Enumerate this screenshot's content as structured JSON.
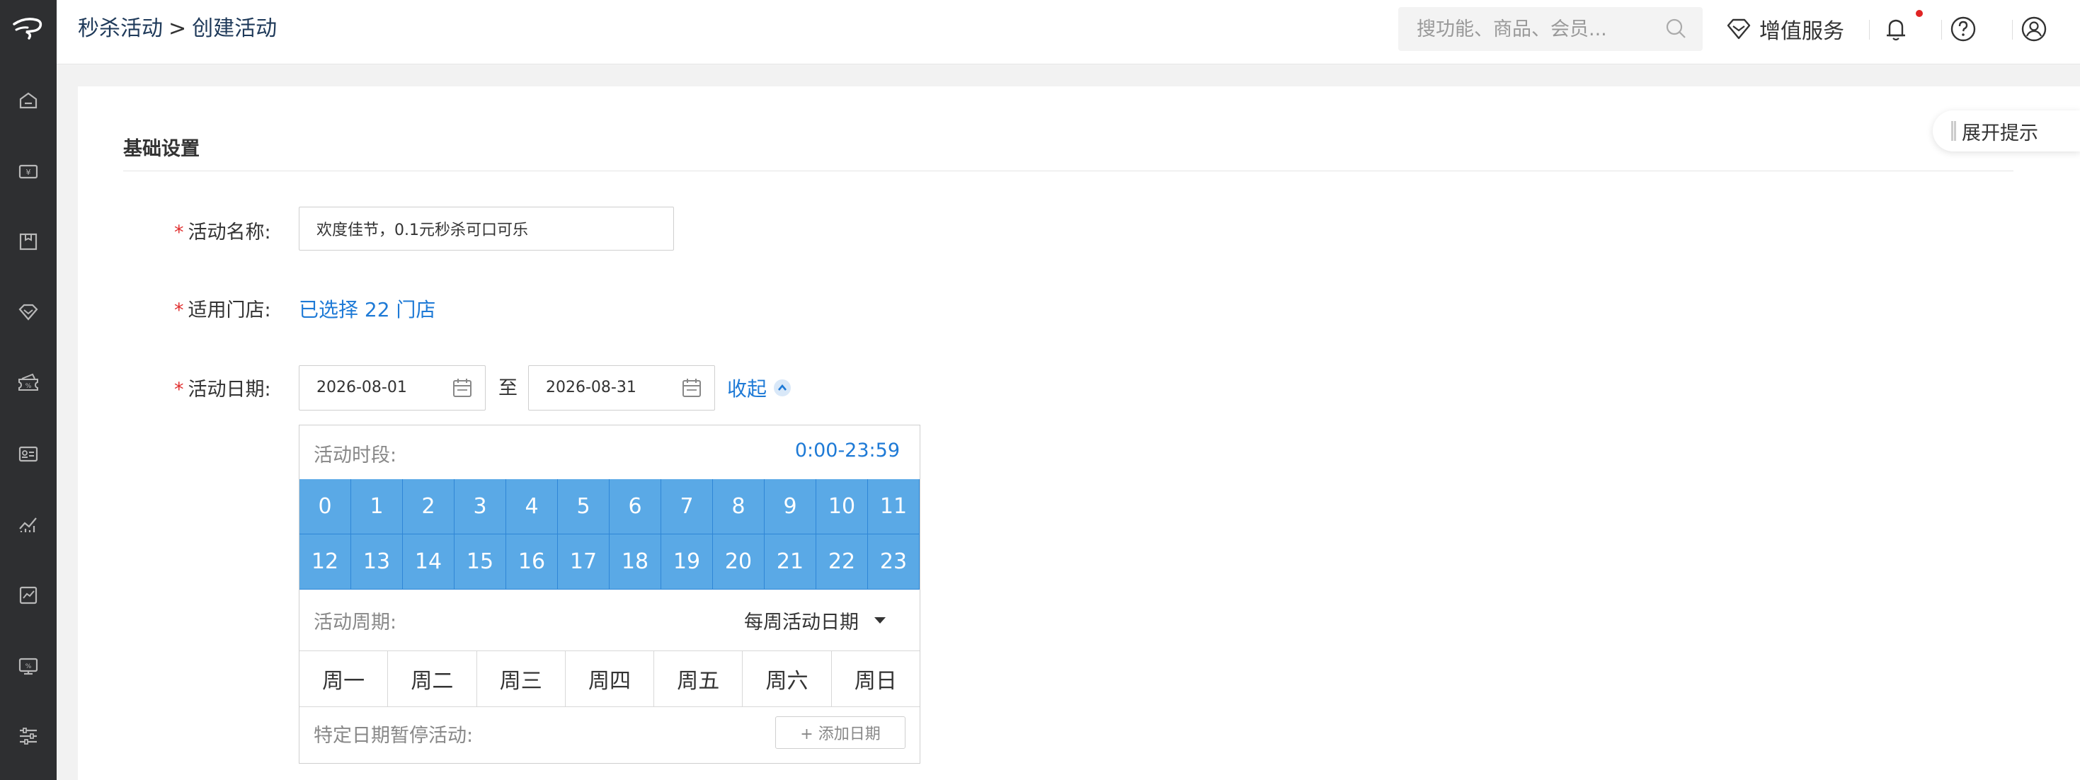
{
  "sidebar": {
    "logo": "app-logo",
    "items": [
      {
        "icon": "home-icon"
      },
      {
        "icon": "cashier-icon"
      },
      {
        "icon": "box-icon"
      },
      {
        "icon": "diamond-icon"
      },
      {
        "icon": "coupon-icon"
      },
      {
        "icon": "member-card-icon"
      },
      {
        "icon": "stats-icon"
      },
      {
        "icon": "report-icon"
      },
      {
        "icon": "monitor-icon"
      },
      {
        "icon": "settings-sliders-icon"
      }
    ]
  },
  "header": {
    "breadcrumb_parent": "秒杀活动",
    "breadcrumb_separator": ">",
    "breadcrumb_current": "创建活动",
    "search_placeholder": "搜功能、商品、会员...",
    "value_added_label": "增值服务",
    "notification_badge": true
  },
  "form": {
    "section_title": "基础设置",
    "hint_button": "展开提示",
    "required_mark": "*",
    "name_label": "活动名称:",
    "name_value": "欢度佳节，0.1元秒杀可口可乐",
    "store_label": "适用门店:",
    "store_value": "已选择 22 门店",
    "date_label": "活动日期:",
    "start_date": "2026-08-01",
    "date_separator": "至",
    "end_date": "2026-08-31",
    "collapse_label": "收起"
  },
  "panel": {
    "period_label": "活动时段:",
    "period_value": "0:00-23:59",
    "hours": [
      "0",
      "1",
      "2",
      "3",
      "4",
      "5",
      "6",
      "7",
      "8",
      "9",
      "10",
      "11",
      "12",
      "13",
      "14",
      "15",
      "16",
      "17",
      "18",
      "19",
      "20",
      "21",
      "22",
      "23"
    ],
    "cycle_label": "活动周期:",
    "cycle_value": "每周活动日期",
    "weekdays": [
      "周一",
      "周二",
      "周三",
      "周四",
      "周五",
      "周六",
      "周日"
    ],
    "pause_label": "特定日期暂停活动:",
    "add_date_label": "+ 添加日期"
  },
  "colors": {
    "sidebar_bg": "#2e2f31",
    "accent_link": "#1e7ad6",
    "hour_selected": "#5aa9e6",
    "required": "#e03030"
  }
}
